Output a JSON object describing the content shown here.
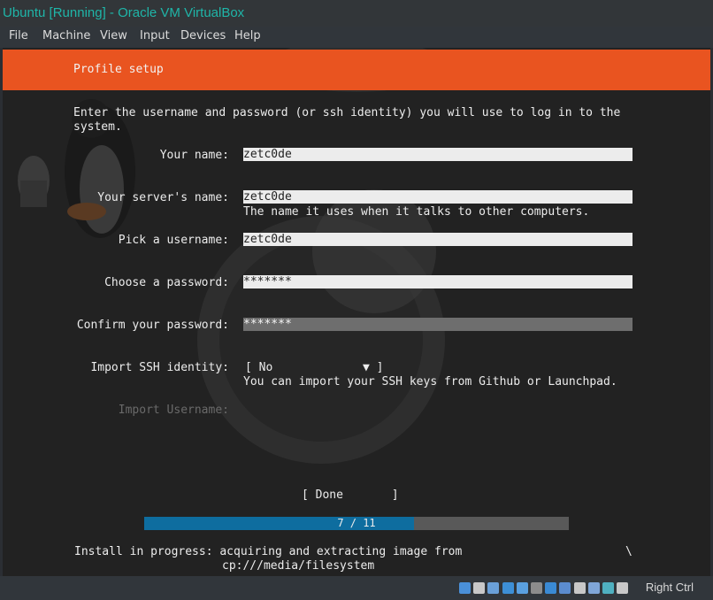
{
  "window": {
    "title": "Ubuntu [Running] - Oracle VM VirtualBox"
  },
  "menu": [
    "File",
    "Machine",
    "View",
    "Input",
    "Devices",
    "Help"
  ],
  "installer": {
    "header": "Profile setup",
    "intro_line1": "Enter the username and password (or ssh identity) you will use to log in to the",
    "intro_line2": "system.",
    "fields": {
      "name": {
        "label": "Your name:",
        "value": "zetc0de"
      },
      "server": {
        "label": "Your server's name:",
        "value": "zetc0de",
        "hint": "The name it uses when it talks to other computers."
      },
      "username": {
        "label": "Pick a username:",
        "value": "zetc0de"
      },
      "password": {
        "label": "Choose a password:",
        "value": "*******"
      },
      "confirm": {
        "label": "Confirm your password:",
        "value": "*******"
      }
    },
    "ssh": {
      "label": "Import SSH identity:",
      "open_bracket": "[ No",
      "arrow": "▼ ]",
      "hint": "You can import your SSH keys from Github or Launchpad."
    },
    "import_username_label": "Import Username:",
    "done_button": "[ Done       ]",
    "progress": {
      "text": "7 / 11",
      "fraction": 0.636
    },
    "status_line1": "Install in progress: acquiring and extracting image from",
    "status_line2": "cp:///media/filesystem",
    "spinner": "\\"
  },
  "statusbar": {
    "host_key": "Right Ctrl",
    "icons": [
      "hard-disk-icon",
      "optical-drive-icon",
      "audio-icon",
      "network-icon",
      "usb-icon",
      "shared-folder-icon",
      "display-icon",
      "video-capture-icon",
      "recording-icon",
      "cpu-icon",
      "mouse-integration-icon",
      "keyboard-capture-icon"
    ]
  },
  "colors": {
    "ubuntu_orange": "#e95420",
    "progress_blue": "#0e6d9f",
    "title_teal": "#1fb5a8"
  }
}
